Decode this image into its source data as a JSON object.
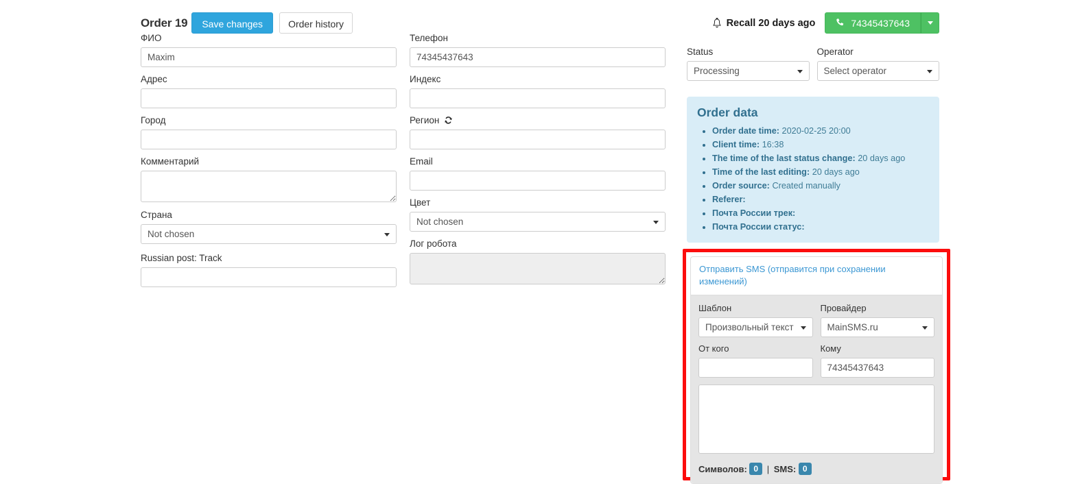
{
  "header": {
    "order_title": "Order 19",
    "save_label": "Save changes",
    "history_label": "Order history",
    "recall_label": "Recall 20 days ago",
    "bell_icon": "bell-icon",
    "phone_icon": "phone-icon",
    "phone_label": "74345437643",
    "caret_icon": "chevron-down-icon"
  },
  "colors": {
    "primary": "#2fa5dd",
    "green": "#4ec163",
    "panel_bg": "#d9edf7",
    "panel_text": "#31708f",
    "badge": "#3a87ad",
    "highlight_border": "#fc0d0d",
    "link": "#3b97d3"
  },
  "form": {
    "left": [
      {
        "label": "ФИО",
        "value": "Maxim",
        "type": "text"
      },
      {
        "label": "Адрес",
        "value": "",
        "type": "text"
      },
      {
        "label": "Город",
        "value": "",
        "type": "text"
      },
      {
        "label": "Комментарий",
        "value": "",
        "type": "textarea"
      },
      {
        "label": "Страна",
        "value": "Not chosen",
        "type": "select"
      },
      {
        "label": "Russian post: Track",
        "value": "",
        "type": "text"
      }
    ],
    "right": [
      {
        "label": "Телефон",
        "value": "74345437643",
        "type": "text"
      },
      {
        "label": "Индекс",
        "value": "",
        "type": "text"
      },
      {
        "label": "Регион",
        "value": "",
        "type": "text",
        "icon": "sync-icon"
      },
      {
        "label": "Email",
        "value": "",
        "type": "text"
      },
      {
        "label": "Цвет",
        "value": "Not chosen",
        "type": "select"
      },
      {
        "label": "Лог робота",
        "value": "",
        "type": "textarea-disabled"
      }
    ]
  },
  "status": {
    "status_label": "Status",
    "status_value": "Processing",
    "operator_label": "Operator",
    "operator_value": "Select operator"
  },
  "order_data": {
    "title": "Order data",
    "items": [
      {
        "key": "Order date time:",
        "value": "2020-02-25 20:00"
      },
      {
        "key": "Client time:",
        "value": "16:38"
      },
      {
        "key": "The time of the last status change:",
        "value": "20 days ago"
      },
      {
        "key": "Time of the last editing:",
        "value": "20 days ago"
      },
      {
        "key": "Order source:",
        "value": "Created manually"
      },
      {
        "key": "Referer:",
        "value": ""
      },
      {
        "key": "Почта России трек:",
        "value": ""
      },
      {
        "key": "Почта России статус:",
        "value": ""
      }
    ]
  },
  "sms": {
    "header_link": "Отправить SMS (отправится при сохранении изменений)",
    "template_label": "Шаблон",
    "template_value": "Произвольный текст",
    "provider_label": "Провайдер",
    "provider_value": "MainSMS.ru",
    "from_label": "От кого",
    "from_value": "",
    "to_label": "Кому",
    "to_value": "74345437643",
    "message_value": "",
    "chars_label": "Символов:",
    "chars_count": "0",
    "separator": "|",
    "sms_label": "SMS:",
    "sms_count": "0"
  }
}
